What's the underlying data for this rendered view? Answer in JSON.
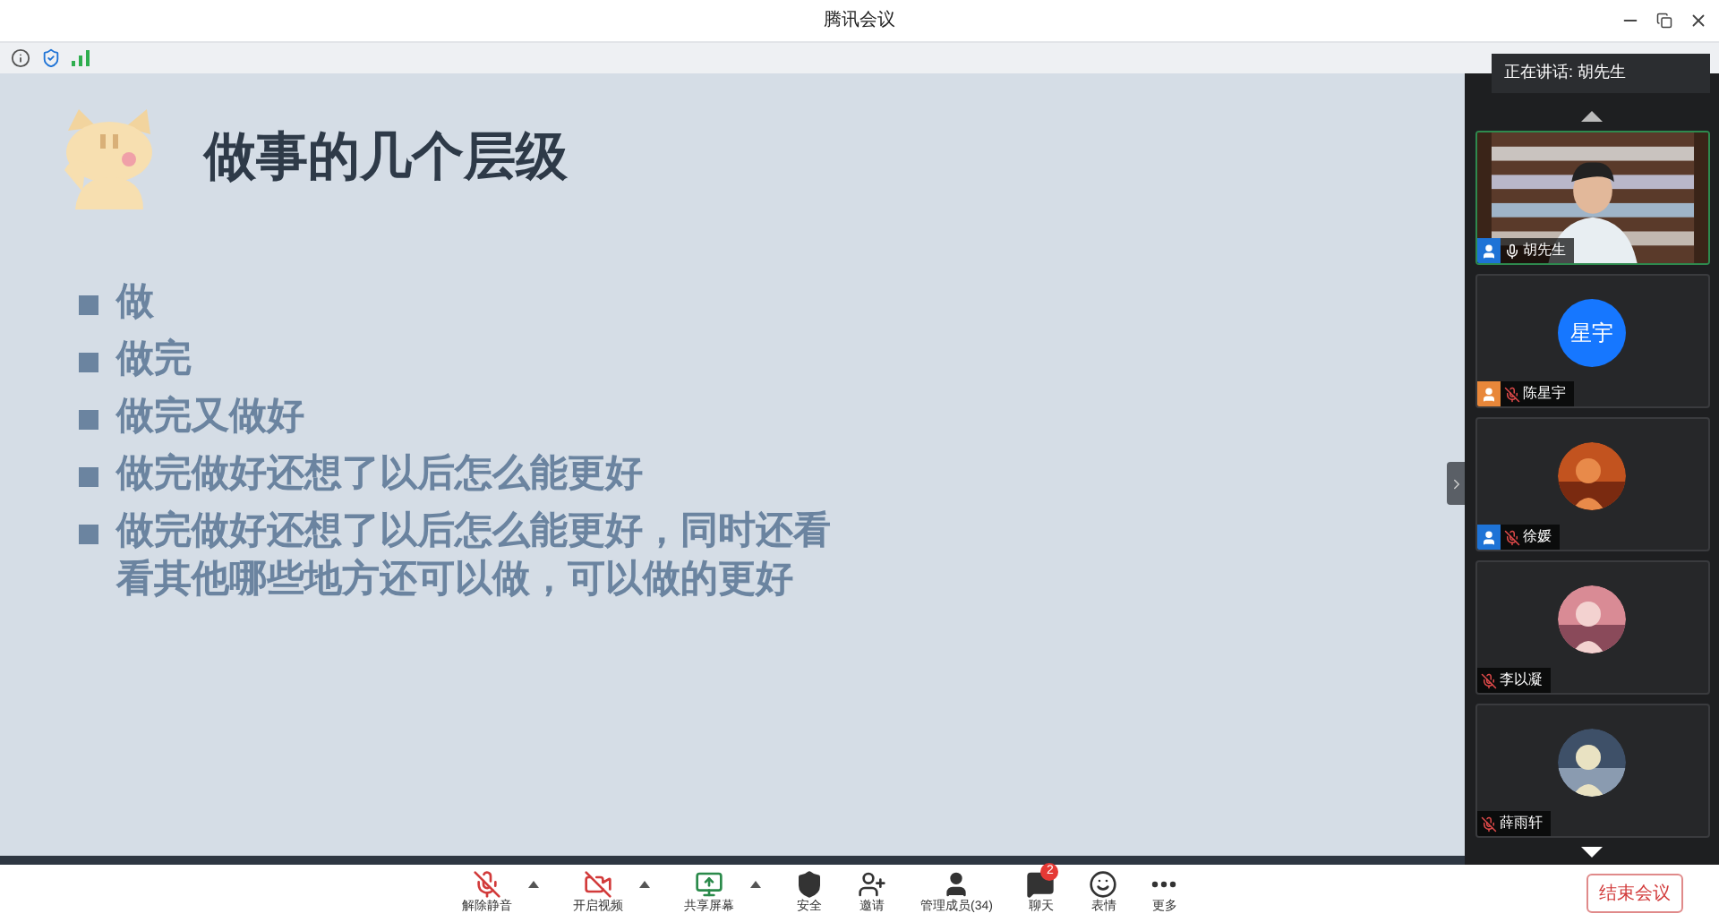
{
  "window": {
    "title": "腾讯会议"
  },
  "slide": {
    "title": "做事的几个层级",
    "bullets": [
      "做",
      "做完",
      "做完又做好",
      "做完做好还想了以后怎么能更好",
      "做完做好还想了以后怎么能更好，同时还看看其他哪些地方还可以做，可以做的更好"
    ]
  },
  "speaking": {
    "label": "正在讲话: 胡先生"
  },
  "participants": [
    {
      "name": "胡先生",
      "kind": "video",
      "muted": false,
      "speaking": true,
      "badge": {
        "color": "#1e73d6"
      }
    },
    {
      "name": "陈星宇",
      "kind": "initials",
      "initials": "星宇",
      "muted": true,
      "speaking": false,
      "badge": {
        "color": "#e8873a"
      }
    },
    {
      "name": "徐媛",
      "muted": true,
      "speaking": false,
      "badge": {
        "color": "#1e73d6"
      }
    },
    {
      "name": "李以凝",
      "muted": true,
      "speaking": false
    },
    {
      "name": "薛雨轩",
      "muted": true,
      "speaking": false
    }
  ],
  "toolbar": [
    {
      "kind": "mic",
      "label": "解除静音",
      "off": true,
      "has_menu": true
    },
    {
      "kind": "video",
      "label": "开启视频",
      "off": true,
      "has_menu": true
    },
    {
      "kind": "share",
      "label": "共享屏幕",
      "has_menu": true
    },
    {
      "kind": "security",
      "label": "安全"
    },
    {
      "kind": "invite",
      "label": "邀请"
    },
    {
      "kind": "members",
      "label": "管理成员(34)"
    },
    {
      "kind": "chat",
      "label": "聊天",
      "badge": "2"
    },
    {
      "kind": "emoji",
      "label": "表情"
    },
    {
      "kind": "more",
      "label": "更多"
    }
  ],
  "end_button": "结束会议"
}
